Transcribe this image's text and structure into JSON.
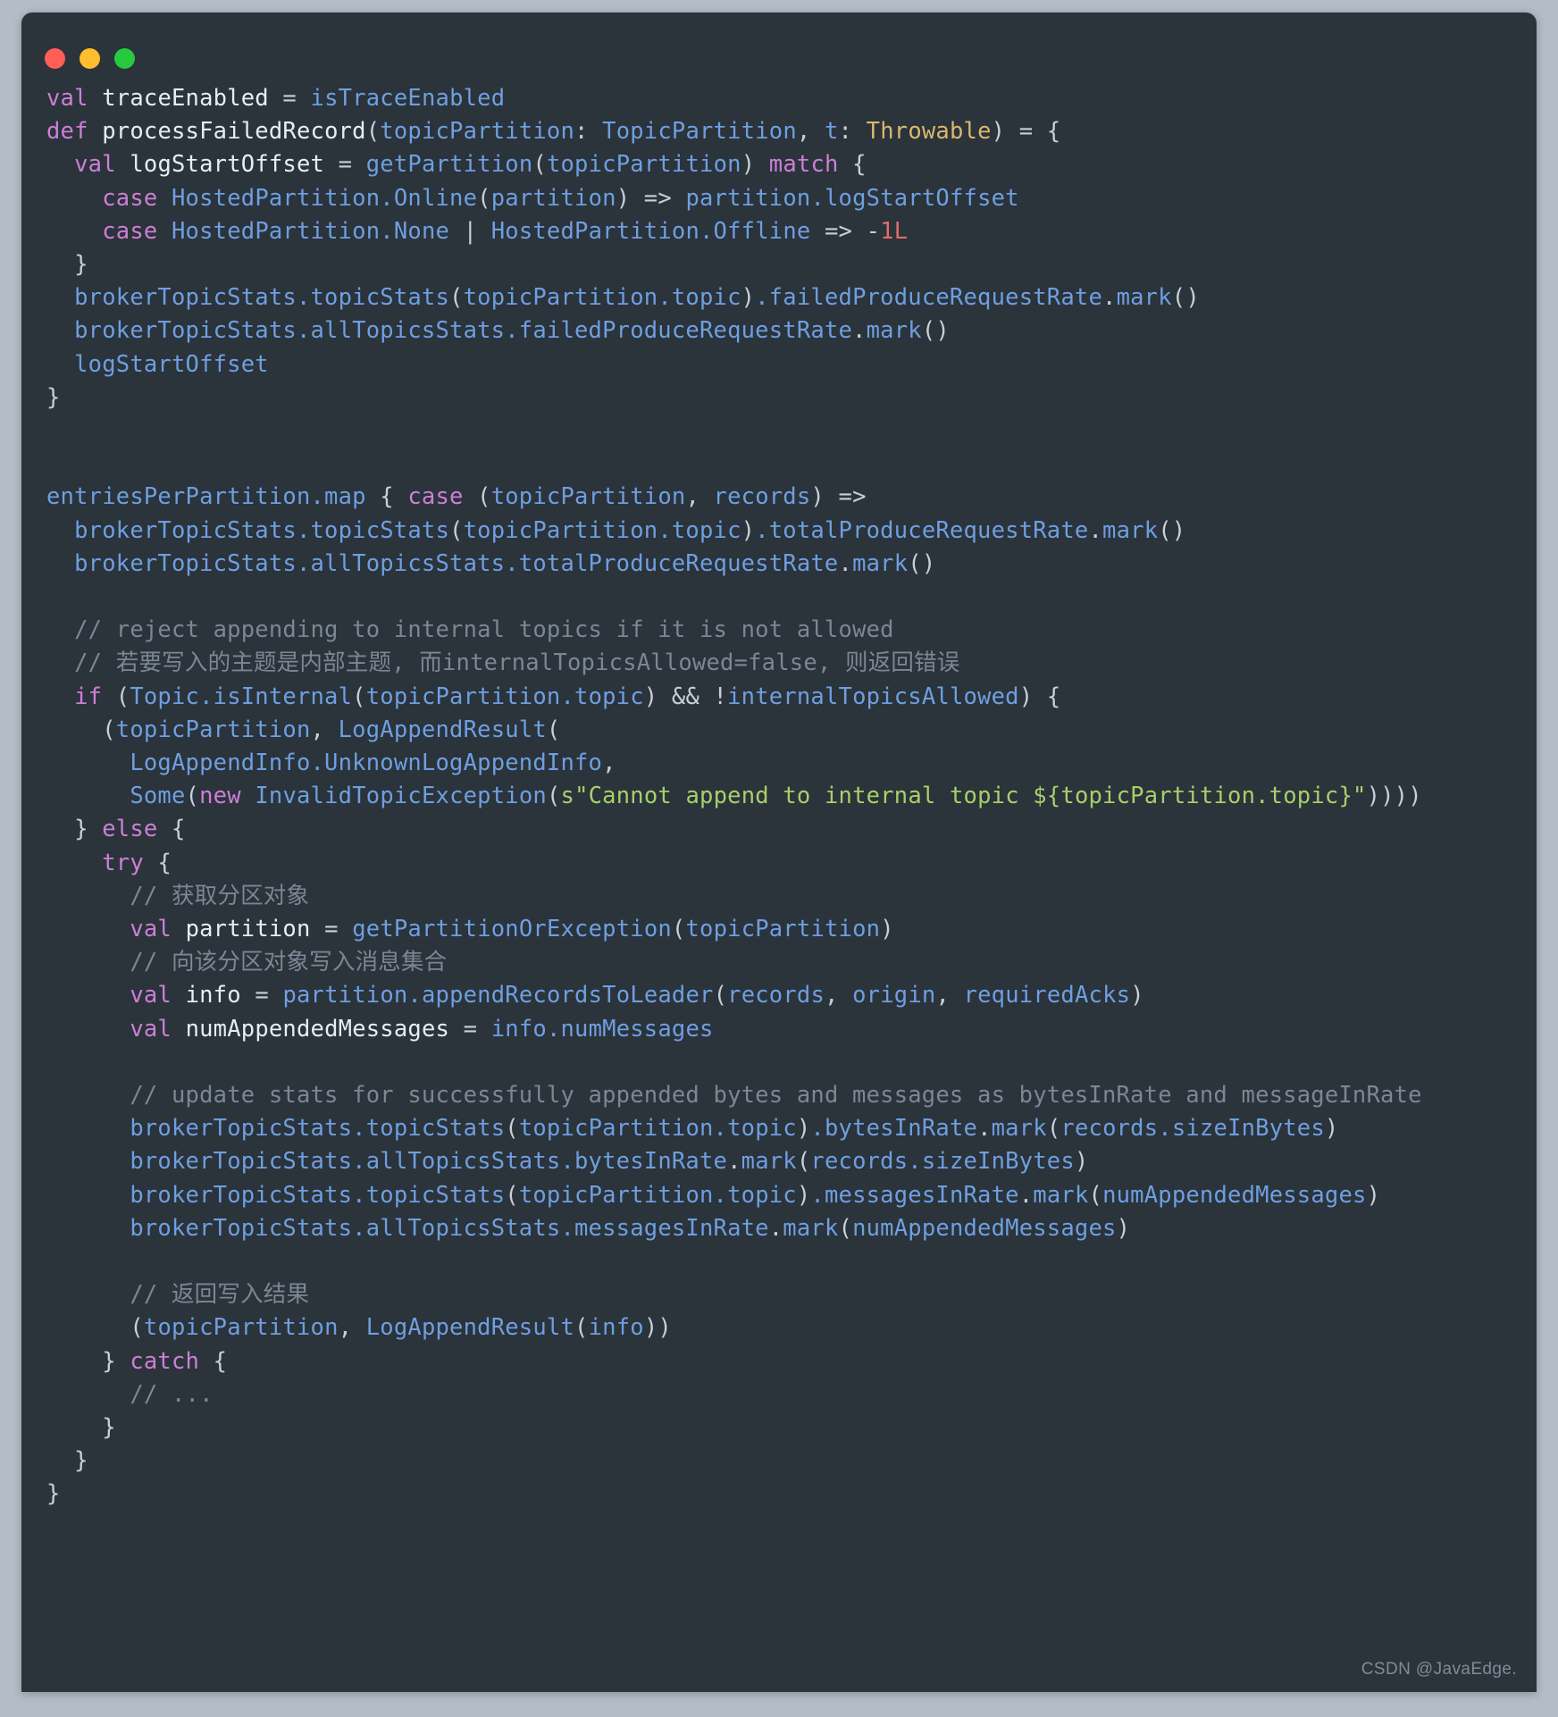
{
  "window": {
    "traffic_lights": [
      {
        "name": "close",
        "color": "#ff5f56"
      },
      {
        "name": "minimize",
        "color": "#ffbd2e"
      },
      {
        "name": "maximize",
        "color": "#27c93f"
      }
    ],
    "background": "#2b333b",
    "desktop_background": "#b4bcc6"
  },
  "watermark": {
    "text": "CSDN @JavaEdge."
  },
  "editor": {
    "language": "scala",
    "theme": "dark",
    "colors": {
      "keyword": "#cc7fd6",
      "identifier": "#e6edf3",
      "function": "#6e9fe0",
      "type": "#d9b86c",
      "number": "#e06c6c",
      "string": "#a6d06a",
      "comment": "#7b8794",
      "punctuation": "#c7d0d9"
    },
    "lines": [
      [
        {
          "t": "val",
          "c": "kw"
        },
        {
          "t": " ",
          "c": "punct"
        },
        {
          "t": "traceEnabled",
          "c": "ident"
        },
        {
          "t": " = ",
          "c": "punct"
        },
        {
          "t": "isTraceEnabled",
          "c": "fn"
        }
      ],
      [
        {
          "t": "def",
          "c": "kw"
        },
        {
          "t": " ",
          "c": "punct"
        },
        {
          "t": "processFailedRecord",
          "c": "ident"
        },
        {
          "t": "(",
          "c": "punct"
        },
        {
          "t": "topicPartition",
          "c": "fn"
        },
        {
          "t": ": ",
          "c": "punct"
        },
        {
          "t": "TopicPartition",
          "c": "fn"
        },
        {
          "t": ", ",
          "c": "punct"
        },
        {
          "t": "t",
          "c": "fn"
        },
        {
          "t": ": ",
          "c": "punct"
        },
        {
          "t": "Throwable",
          "c": "type"
        },
        {
          "t": ") = {",
          "c": "punct"
        }
      ],
      [
        {
          "t": "  ",
          "c": "punct"
        },
        {
          "t": "val",
          "c": "kw"
        },
        {
          "t": " ",
          "c": "punct"
        },
        {
          "t": "logStartOffset",
          "c": "ident"
        },
        {
          "t": " = ",
          "c": "punct"
        },
        {
          "t": "getPartition",
          "c": "fn"
        },
        {
          "t": "(",
          "c": "punct"
        },
        {
          "t": "topicPartition",
          "c": "fn"
        },
        {
          "t": ") ",
          "c": "punct"
        },
        {
          "t": "match",
          "c": "kw"
        },
        {
          "t": " {",
          "c": "punct"
        }
      ],
      [
        {
          "t": "    ",
          "c": "punct"
        },
        {
          "t": "case",
          "c": "kw"
        },
        {
          "t": " ",
          "c": "punct"
        },
        {
          "t": "HostedPartition.Online",
          "c": "fn"
        },
        {
          "t": "(",
          "c": "punct"
        },
        {
          "t": "partition",
          "c": "fn"
        },
        {
          "t": ") => ",
          "c": "punct"
        },
        {
          "t": "partition.logStartOffset",
          "c": "fn"
        }
      ],
      [
        {
          "t": "    ",
          "c": "punct"
        },
        {
          "t": "case",
          "c": "kw"
        },
        {
          "t": " ",
          "c": "punct"
        },
        {
          "t": "HostedPartition.None",
          "c": "fn"
        },
        {
          "t": " | ",
          "c": "punct"
        },
        {
          "t": "HostedPartition.Offline",
          "c": "fn"
        },
        {
          "t": " => -",
          "c": "punct"
        },
        {
          "t": "1L",
          "c": "num"
        }
      ],
      [
        {
          "t": "  }",
          "c": "punct"
        }
      ],
      [
        {
          "t": "  ",
          "c": "punct"
        },
        {
          "t": "brokerTopicStats.topicStats",
          "c": "fn"
        },
        {
          "t": "(",
          "c": "punct"
        },
        {
          "t": "topicPartition.topic",
          "c": "fn"
        },
        {
          "t": ")",
          "c": "punct"
        },
        {
          "t": ".failedProduceRequestRate",
          "c": "fn"
        },
        {
          "t": ".",
          "c": "punct"
        },
        {
          "t": "mark",
          "c": "fn"
        },
        {
          "t": "()",
          "c": "punct"
        }
      ],
      [
        {
          "t": "  ",
          "c": "punct"
        },
        {
          "t": "brokerTopicStats.allTopicsStats.failedProduceRequestRate",
          "c": "fn"
        },
        {
          "t": ".",
          "c": "punct"
        },
        {
          "t": "mark",
          "c": "fn"
        },
        {
          "t": "()",
          "c": "punct"
        }
      ],
      [
        {
          "t": "  ",
          "c": "punct"
        },
        {
          "t": "logStartOffset",
          "c": "fn"
        }
      ],
      [
        {
          "t": "}",
          "c": "punct"
        }
      ],
      [],
      [],
      [
        {
          "t": "entriesPerPartition.map",
          "c": "fn"
        },
        {
          "t": " { ",
          "c": "punct"
        },
        {
          "t": "case",
          "c": "kw"
        },
        {
          "t": " (",
          "c": "punct"
        },
        {
          "t": "topicPartition",
          "c": "fn"
        },
        {
          "t": ", ",
          "c": "punct"
        },
        {
          "t": "records",
          "c": "fn"
        },
        {
          "t": ") =>",
          "c": "punct"
        }
      ],
      [
        {
          "t": "  ",
          "c": "punct"
        },
        {
          "t": "brokerTopicStats.topicStats",
          "c": "fn"
        },
        {
          "t": "(",
          "c": "punct"
        },
        {
          "t": "topicPartition.topic",
          "c": "fn"
        },
        {
          "t": ")",
          "c": "punct"
        },
        {
          "t": ".totalProduceRequestRate",
          "c": "fn"
        },
        {
          "t": ".",
          "c": "punct"
        },
        {
          "t": "mark",
          "c": "fn"
        },
        {
          "t": "()",
          "c": "punct"
        }
      ],
      [
        {
          "t": "  ",
          "c": "punct"
        },
        {
          "t": "brokerTopicStats.allTopicsStats.totalProduceRequestRate",
          "c": "fn"
        },
        {
          "t": ".",
          "c": "punct"
        },
        {
          "t": "mark",
          "c": "fn"
        },
        {
          "t": "()",
          "c": "punct"
        }
      ],
      [],
      [
        {
          "t": "  // reject appending to internal topics if it is not allowed",
          "c": "cmt"
        }
      ],
      [
        {
          "t": "  // 若要写入的主题是内部主题, 而internalTopicsAllowed=false, 则返回错误",
          "c": "cmt"
        }
      ],
      [
        {
          "t": "  ",
          "c": "punct"
        },
        {
          "t": "if",
          "c": "kw"
        },
        {
          "t": " (",
          "c": "punct"
        },
        {
          "t": "Topic.isInternal",
          "c": "fn"
        },
        {
          "t": "(",
          "c": "punct"
        },
        {
          "t": "topicPartition.topic",
          "c": "fn"
        },
        {
          "t": ") && !",
          "c": "punct"
        },
        {
          "t": "internalTopicsAllowed",
          "c": "fn"
        },
        {
          "t": ") {",
          "c": "punct"
        }
      ],
      [
        {
          "t": "    (",
          "c": "punct"
        },
        {
          "t": "topicPartition",
          "c": "fn"
        },
        {
          "t": ", ",
          "c": "punct"
        },
        {
          "t": "LogAppendResult",
          "c": "fn"
        },
        {
          "t": "(",
          "c": "punct"
        }
      ],
      [
        {
          "t": "      ",
          "c": "punct"
        },
        {
          "t": "LogAppendInfo.UnknownLogAppendInfo",
          "c": "fn"
        },
        {
          "t": ",",
          "c": "punct"
        }
      ],
      [
        {
          "t": "      ",
          "c": "punct"
        },
        {
          "t": "Some",
          "c": "fn"
        },
        {
          "t": "(",
          "c": "punct"
        },
        {
          "t": "new",
          "c": "kw"
        },
        {
          "t": " ",
          "c": "punct"
        },
        {
          "t": "InvalidTopicException",
          "c": "fn"
        },
        {
          "t": "(",
          "c": "punct"
        },
        {
          "t": "s\"Cannot append to internal topic ${topicPartition.topic}\"",
          "c": "str"
        },
        {
          "t": "))))",
          "c": "punct"
        }
      ],
      [
        {
          "t": "  } ",
          "c": "punct"
        },
        {
          "t": "else",
          "c": "kw"
        },
        {
          "t": " {",
          "c": "punct"
        }
      ],
      [
        {
          "t": "    ",
          "c": "punct"
        },
        {
          "t": "try",
          "c": "kw"
        },
        {
          "t": " {",
          "c": "punct"
        }
      ],
      [
        {
          "t": "      // 获取分区对象",
          "c": "cmt"
        }
      ],
      [
        {
          "t": "      ",
          "c": "punct"
        },
        {
          "t": "val",
          "c": "kw"
        },
        {
          "t": " ",
          "c": "punct"
        },
        {
          "t": "partition",
          "c": "ident"
        },
        {
          "t": " = ",
          "c": "punct"
        },
        {
          "t": "getPartitionOrException",
          "c": "fn"
        },
        {
          "t": "(",
          "c": "punct"
        },
        {
          "t": "topicPartition",
          "c": "fn"
        },
        {
          "t": ")",
          "c": "punct"
        }
      ],
      [
        {
          "t": "      // 向该分区对象写入消息集合",
          "c": "cmt"
        }
      ],
      [
        {
          "t": "      ",
          "c": "punct"
        },
        {
          "t": "val",
          "c": "kw"
        },
        {
          "t": " ",
          "c": "punct"
        },
        {
          "t": "info",
          "c": "ident"
        },
        {
          "t": " = ",
          "c": "punct"
        },
        {
          "t": "partition.appendRecordsToLeader",
          "c": "fn"
        },
        {
          "t": "(",
          "c": "punct"
        },
        {
          "t": "records",
          "c": "fn"
        },
        {
          "t": ", ",
          "c": "punct"
        },
        {
          "t": "origin",
          "c": "fn"
        },
        {
          "t": ", ",
          "c": "punct"
        },
        {
          "t": "requiredAcks",
          "c": "fn"
        },
        {
          "t": ")",
          "c": "punct"
        }
      ],
      [
        {
          "t": "      ",
          "c": "punct"
        },
        {
          "t": "val",
          "c": "kw"
        },
        {
          "t": " ",
          "c": "punct"
        },
        {
          "t": "numAppendedMessages",
          "c": "ident"
        },
        {
          "t": " = ",
          "c": "punct"
        },
        {
          "t": "info.numMessages",
          "c": "fn"
        }
      ],
      [],
      [
        {
          "t": "      // update stats for successfully appended bytes and messages as bytesInRate and messageInRate",
          "c": "cmt"
        }
      ],
      [
        {
          "t": "      ",
          "c": "punct"
        },
        {
          "t": "brokerTopicStats.topicStats",
          "c": "fn"
        },
        {
          "t": "(",
          "c": "punct"
        },
        {
          "t": "topicPartition.topic",
          "c": "fn"
        },
        {
          "t": ")",
          "c": "punct"
        },
        {
          "t": ".bytesInRate",
          "c": "fn"
        },
        {
          "t": ".",
          "c": "punct"
        },
        {
          "t": "mark",
          "c": "fn"
        },
        {
          "t": "(",
          "c": "punct"
        },
        {
          "t": "records.sizeInBytes",
          "c": "fn"
        },
        {
          "t": ")",
          "c": "punct"
        }
      ],
      [
        {
          "t": "      ",
          "c": "punct"
        },
        {
          "t": "brokerTopicStats.allTopicsStats.bytesInRate",
          "c": "fn"
        },
        {
          "t": ".",
          "c": "punct"
        },
        {
          "t": "mark",
          "c": "fn"
        },
        {
          "t": "(",
          "c": "punct"
        },
        {
          "t": "records.sizeInBytes",
          "c": "fn"
        },
        {
          "t": ")",
          "c": "punct"
        }
      ],
      [
        {
          "t": "      ",
          "c": "punct"
        },
        {
          "t": "brokerTopicStats.topicStats",
          "c": "fn"
        },
        {
          "t": "(",
          "c": "punct"
        },
        {
          "t": "topicPartition.topic",
          "c": "fn"
        },
        {
          "t": ")",
          "c": "punct"
        },
        {
          "t": ".messagesInRate",
          "c": "fn"
        },
        {
          "t": ".",
          "c": "punct"
        },
        {
          "t": "mark",
          "c": "fn"
        },
        {
          "t": "(",
          "c": "punct"
        },
        {
          "t": "numAppendedMessages",
          "c": "fn"
        },
        {
          "t": ")",
          "c": "punct"
        }
      ],
      [
        {
          "t": "      ",
          "c": "punct"
        },
        {
          "t": "brokerTopicStats.allTopicsStats.messagesInRate",
          "c": "fn"
        },
        {
          "t": ".",
          "c": "punct"
        },
        {
          "t": "mark",
          "c": "fn"
        },
        {
          "t": "(",
          "c": "punct"
        },
        {
          "t": "numAppendedMessages",
          "c": "fn"
        },
        {
          "t": ")",
          "c": "punct"
        }
      ],
      [],
      [
        {
          "t": "      // 返回写入结果",
          "c": "cmt"
        }
      ],
      [
        {
          "t": "      (",
          "c": "punct"
        },
        {
          "t": "topicPartition",
          "c": "fn"
        },
        {
          "t": ", ",
          "c": "punct"
        },
        {
          "t": "LogAppendResult",
          "c": "fn"
        },
        {
          "t": "(",
          "c": "punct"
        },
        {
          "t": "info",
          "c": "fn"
        },
        {
          "t": "))",
          "c": "punct"
        }
      ],
      [
        {
          "t": "    } ",
          "c": "punct"
        },
        {
          "t": "catch",
          "c": "kw"
        },
        {
          "t": " {",
          "c": "punct"
        }
      ],
      [
        {
          "t": "      // ...",
          "c": "cmt"
        }
      ],
      [
        {
          "t": "    }",
          "c": "punct"
        }
      ],
      [
        {
          "t": "  }",
          "c": "punct"
        }
      ],
      [
        {
          "t": "}",
          "c": "punct"
        }
      ]
    ]
  }
}
